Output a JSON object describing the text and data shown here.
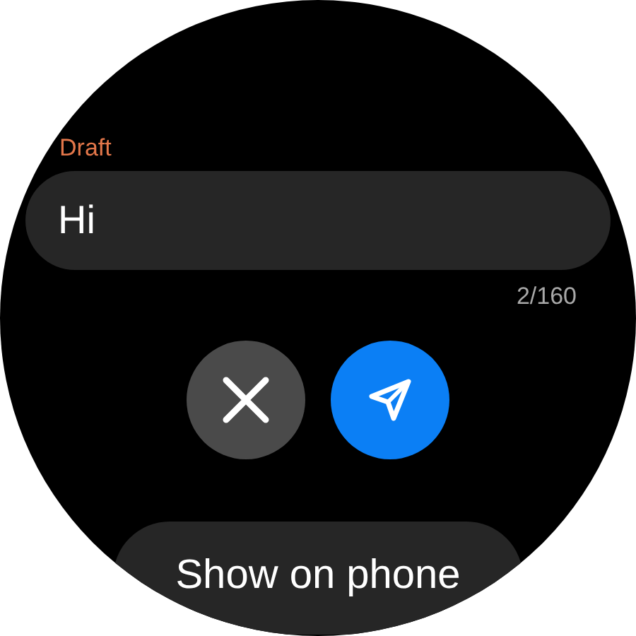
{
  "draft_label": "Draft",
  "message_field": {
    "value": "Hi"
  },
  "char_count": "2/160",
  "buttons": [
    {
      "kind": "cancel"
    },
    {
      "kind": "send"
    }
  ],
  "show_on_phone_button": "Show on phone"
}
